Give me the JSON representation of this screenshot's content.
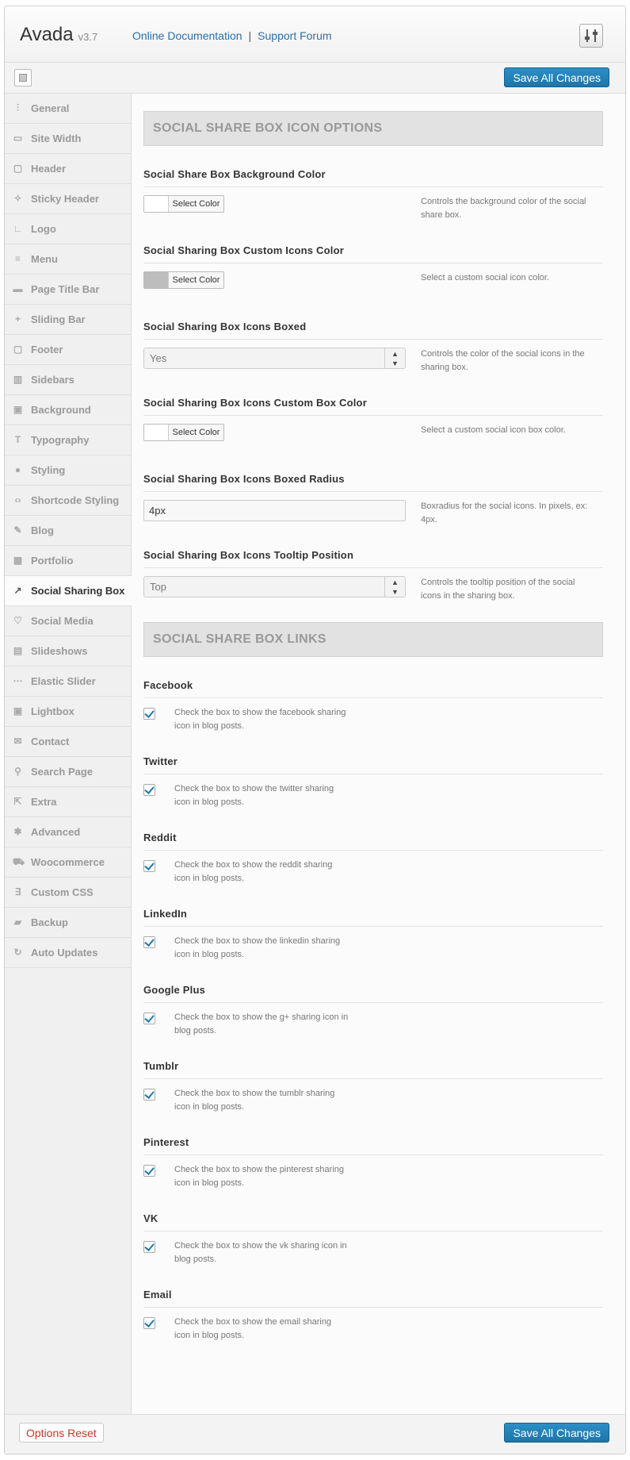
{
  "header": {
    "brand": "Avada",
    "version": "v3.7",
    "doc_link": "Online Documentation",
    "separator": "|",
    "forum_link": "Support Forum",
    "settings_icon": "settings-sliders-icon"
  },
  "toolbar": {
    "save_label": "Save All Changes"
  },
  "sidebar": {
    "items": [
      {
        "label": "General",
        "icon": "sliders-icon"
      },
      {
        "label": "Site Width",
        "icon": "width-icon"
      },
      {
        "label": "Header",
        "icon": "header-icon"
      },
      {
        "label": "Sticky Header",
        "icon": "pin-icon"
      },
      {
        "label": "Logo",
        "icon": "logo-icon"
      },
      {
        "label": "Menu",
        "icon": "menu-icon"
      },
      {
        "label": "Page Title Bar",
        "icon": "title-bar-icon"
      },
      {
        "label": "Sliding Bar",
        "icon": "plus-icon"
      },
      {
        "label": "Footer",
        "icon": "footer-icon"
      },
      {
        "label": "Sidebars",
        "icon": "sidebars-icon"
      },
      {
        "label": "Background",
        "icon": "image-icon"
      },
      {
        "label": "Typography",
        "icon": "typography-icon"
      },
      {
        "label": "Styling",
        "icon": "drop-icon"
      },
      {
        "label": "Shortcode Styling",
        "icon": "code-icon"
      },
      {
        "label": "Blog",
        "icon": "feather-icon"
      },
      {
        "label": "Portfolio",
        "icon": "portfolio-icon"
      },
      {
        "label": "Social Sharing Box",
        "icon": "share-icon"
      },
      {
        "label": "Social Media",
        "icon": "heart-icon"
      },
      {
        "label": "Slideshows",
        "icon": "slideshow-icon"
      },
      {
        "label": "Elastic Slider",
        "icon": "dots-icon"
      },
      {
        "label": "Lightbox",
        "icon": "lightbox-icon"
      },
      {
        "label": "Contact",
        "icon": "mail-icon"
      },
      {
        "label": "Search Page",
        "icon": "search-icon"
      },
      {
        "label": "Extra",
        "icon": "external-icon"
      },
      {
        "label": "Advanced",
        "icon": "asterisk-icon"
      },
      {
        "label": "Woocommerce",
        "icon": "cart-icon"
      },
      {
        "label": "Custom CSS",
        "icon": "css-icon"
      },
      {
        "label": "Backup",
        "icon": "backup-icon"
      },
      {
        "label": "Auto Updates",
        "icon": "refresh-icon"
      }
    ]
  },
  "main": {
    "section1_title": "SOCIAL SHARE BOX ICON OPTIONS",
    "bg_color": {
      "title": "Social Share Box Background Color",
      "button": "Select Color",
      "desc": "Controls the background color of the social share box."
    },
    "icons_color": {
      "title": "Social Sharing Box Custom Icons Color",
      "button": "Select Color",
      "desc": "Select a custom social icon color."
    },
    "icons_boxed": {
      "title": "Social Sharing Box Icons Boxed",
      "value": "Yes",
      "desc": "Controls the color of the social icons in the sharing box."
    },
    "box_color": {
      "title": "Social Sharing Box Icons Custom Box Color",
      "button": "Select Color",
      "desc": "Select a custom social icon box color."
    },
    "boxed_radius": {
      "title": "Social Sharing Box Icons Boxed Radius",
      "value": "4px",
      "desc": "Boxradius for the social icons. In pixels, ex: 4px."
    },
    "tooltip_position": {
      "title": "Social Sharing Box Icons Tooltip Position",
      "value": "Top",
      "desc": "Controls the tooltip position of the social icons in the sharing box."
    },
    "section2_title": "SOCIAL SHARE BOX LINKS",
    "links": [
      {
        "title": "Facebook",
        "desc": "Check the box to show the facebook sharing icon in blog posts.",
        "checked": true
      },
      {
        "title": "Twitter",
        "desc": "Check the box to show the twitter sharing icon in blog posts.",
        "checked": true
      },
      {
        "title": "Reddit",
        "desc": "Check the box to show the reddit sharing icon in blog posts.",
        "checked": true
      },
      {
        "title": "LinkedIn",
        "desc": "Check the box to show the linkedin sharing icon in blog posts.",
        "checked": true
      },
      {
        "title": "Google Plus",
        "desc": "Check the box to show the g+ sharing icon in blog posts.",
        "checked": true
      },
      {
        "title": "Tumblr",
        "desc": "Check the box to show the tumblr sharing icon in blog posts.",
        "checked": true
      },
      {
        "title": "Pinterest",
        "desc": "Check the box to show the pinterest sharing icon in blog posts.",
        "checked": true
      },
      {
        "title": "VK",
        "desc": "Check the box to show the vk sharing icon in blog posts.",
        "checked": true
      },
      {
        "title": "Email",
        "desc": "Check the box to show the email sharing icon in blog posts.",
        "checked": true
      }
    ]
  },
  "footer": {
    "reset_label": "Options Reset",
    "save_label": "Save All Changes"
  },
  "colors": {
    "accent": "#1e75a8",
    "reset_text": "#c0392b",
    "link": "#2a6fa8"
  }
}
